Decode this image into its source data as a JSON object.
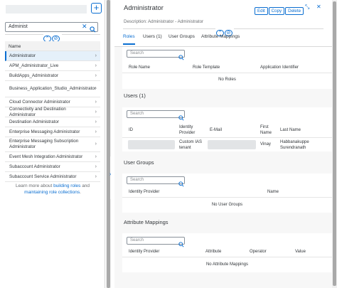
{
  "master": {
    "add_label": "+",
    "search_value": "Administ",
    "list_header": "Name",
    "items": [
      {
        "label": "Administrator",
        "selected": true
      },
      {
        "label": "APM_Administrator_Live"
      },
      {
        "label": "BuildApps_Administrator"
      },
      {
        "label": "Business_Application_Studio_Administrator"
      },
      {
        "label": "Cloud Connector Administrator"
      },
      {
        "label": "Connectivity and Destination Administrator"
      },
      {
        "label": "Destination Administrator"
      },
      {
        "label": "Enterprise Messaging Administrator"
      },
      {
        "label": "Enterprise Messaging Subscription Administrator"
      },
      {
        "label": "Event Mesh Integration Administrator"
      },
      {
        "label": "Subaccount Administrator"
      },
      {
        "label": "Subaccount Service Administrator"
      }
    ],
    "learn_prefix": "Learn more about ",
    "learn_link1": "building roles",
    "learn_mid": " and ",
    "learn_link2": "maintaining role collections",
    "learn_suffix": "."
  },
  "detail": {
    "title": "Administrator",
    "description": "Description: Administrator - Administrator",
    "buttons": {
      "edit": "Edit",
      "copy": "Copy",
      "delete": "Delete"
    },
    "tabs": [
      "Roles",
      "Users (1)",
      "User Groups",
      "Attribute Mappings"
    ],
    "roles": {
      "search_placeholder": "Search",
      "columns": [
        "Role Name",
        "Role Template",
        "Application Identifier"
      ],
      "empty": "No Roles"
    },
    "users": {
      "title": "Users (1)",
      "search_placeholder": "Search",
      "columns": [
        "ID",
        "Identity Provider",
        "E-Mail",
        "First Name",
        "Last Name"
      ],
      "row": {
        "identity_provider": "Custom IAS tenant",
        "first_name": "Vinay",
        "last_name": "Habbanakuppe Surendranath"
      }
    },
    "groups": {
      "title": "User Groups",
      "search_placeholder": "Search",
      "columns": [
        "Identity Provider",
        "Name"
      ],
      "empty": "No User Groups"
    },
    "mappings": {
      "title": "Attribute Mappings",
      "search_placeholder": "Search",
      "columns": [
        "Identity Provider",
        "Attribute",
        "Operator",
        "Value"
      ],
      "empty": "No Attribute Mappings"
    }
  }
}
